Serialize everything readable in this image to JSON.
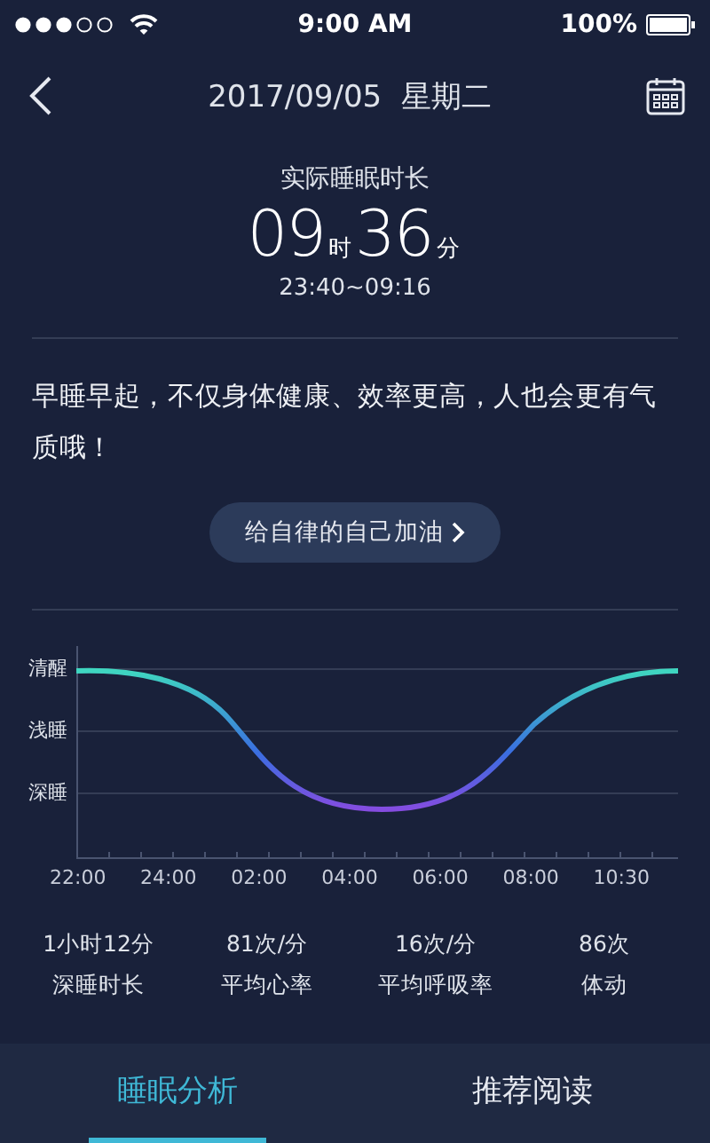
{
  "status_bar": {
    "time": "9:00 AM",
    "battery": "100%"
  },
  "header": {
    "date": "2017/09/05  星期二"
  },
  "summary": {
    "label": "实际睡眠时长",
    "hours": "09",
    "hours_unit": "时",
    "minutes": "36",
    "minutes_unit": "分",
    "range": "23:40~09:16"
  },
  "tip": {
    "text": "早睡早起，不仅身体健康、效率更高，人也会更有气质哦！",
    "button": "给自律的自己加油"
  },
  "chart": {
    "y_labels": [
      "清醒",
      "浅睡",
      "深睡"
    ],
    "x_labels": [
      "22:00",
      "24:00",
      "02:00",
      "04:00",
      "06:00",
      "08:00",
      "10:30"
    ]
  },
  "stats": [
    {
      "value": "1小时12分",
      "label": "深睡时长"
    },
    {
      "value": "81次/分",
      "label": "平均心率"
    },
    {
      "value": "16次/分",
      "label": "平均呼吸率"
    },
    {
      "value": "86次",
      "label": "体动"
    }
  ],
  "tabs": [
    {
      "label": "睡眠分析",
      "selected": true
    },
    {
      "label": "推荐阅读",
      "selected": false
    }
  ]
}
